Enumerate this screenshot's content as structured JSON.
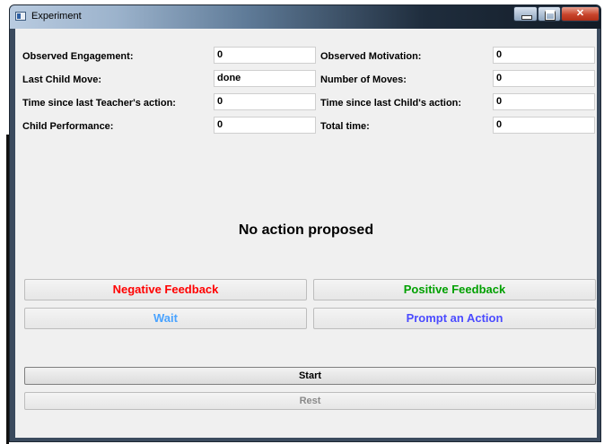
{
  "window": {
    "title": "Experiment"
  },
  "fields": {
    "observed_engagement": {
      "label": "Observed Engagement:",
      "value": "0"
    },
    "observed_motivation": {
      "label": "Observed Motivation:",
      "value": "0"
    },
    "last_child_move": {
      "label": "Last Child Move:",
      "value": "done"
    },
    "number_of_moves": {
      "label": "Number of Moves:",
      "value": "0"
    },
    "time_since_teacher": {
      "label": "Time since last Teacher's action:",
      "value": "0"
    },
    "time_since_child": {
      "label": "Time since last Child's action:",
      "value": "0"
    },
    "child_performance": {
      "label": "Child Performance:",
      "value": "0"
    },
    "total_time": {
      "label": "Total time:",
      "value": "0"
    }
  },
  "status": "No action proposed",
  "actions": {
    "negative_feedback": {
      "label": "Negative Feedback",
      "color": "#ff0000"
    },
    "positive_feedback": {
      "label": "Positive Feedback",
      "color": "#00a000"
    },
    "wait": {
      "label": "Wait",
      "color": "#4aa3ff"
    },
    "prompt_action": {
      "label": "Prompt an Action",
      "color": "#4b4bff"
    }
  },
  "controls": {
    "start": "Start",
    "rest": "Rest"
  },
  "icons": {
    "app": "app-window-icon",
    "minimize": "minimize-icon",
    "maximize": "maximize-icon",
    "close": "close-icon"
  }
}
